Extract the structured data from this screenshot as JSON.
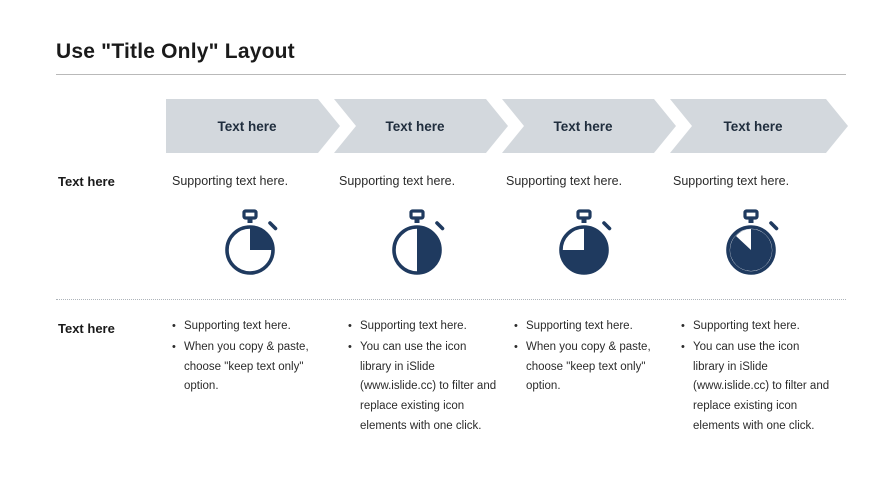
{
  "slide": {
    "title": "Use \"Title Only\" Layout",
    "colors": {
      "chevron_fill": "#d3d8dd",
      "icon": "#1f3a5f",
      "text": "#2b2b2b",
      "title": "#1a1a1a",
      "rule": "#b9b9b9"
    },
    "chevrons": [
      {
        "label": "Text here"
      },
      {
        "label": "Text here"
      },
      {
        "label": "Text here"
      },
      {
        "label": "Text here"
      }
    ],
    "row_labels": {
      "upper": "Text here",
      "lower": "Text here"
    },
    "upper_columns": [
      {
        "support": "Supporting text here.",
        "icon": "stopwatch-icon",
        "fill_percent": 25
      },
      {
        "support": "Supporting text here.",
        "icon": "stopwatch-icon",
        "fill_percent": 50
      },
      {
        "support": "Supporting text here.",
        "icon": "stopwatch-icon",
        "fill_percent": 75
      },
      {
        "support": "Supporting text here.",
        "icon": "stopwatch-icon",
        "fill_percent": 100
      }
    ],
    "lower_columns": [
      {
        "bullets": [
          "Supporting text here.",
          "When you copy & paste, choose \"keep text only\" option."
        ]
      },
      {
        "bullets": [
          "Supporting text here.",
          "You can use the icon library in iSlide (www.islide.cc) to filter and replace existing icon elements with one click."
        ]
      },
      {
        "bullets": [
          "Supporting text here.",
          "When you copy & paste, choose \"keep text only\" option."
        ]
      },
      {
        "bullets": [
          "Supporting text here.",
          "You can use the icon library in iSlide (www.islide.cc) to filter and replace existing icon elements with one click."
        ]
      }
    ]
  }
}
